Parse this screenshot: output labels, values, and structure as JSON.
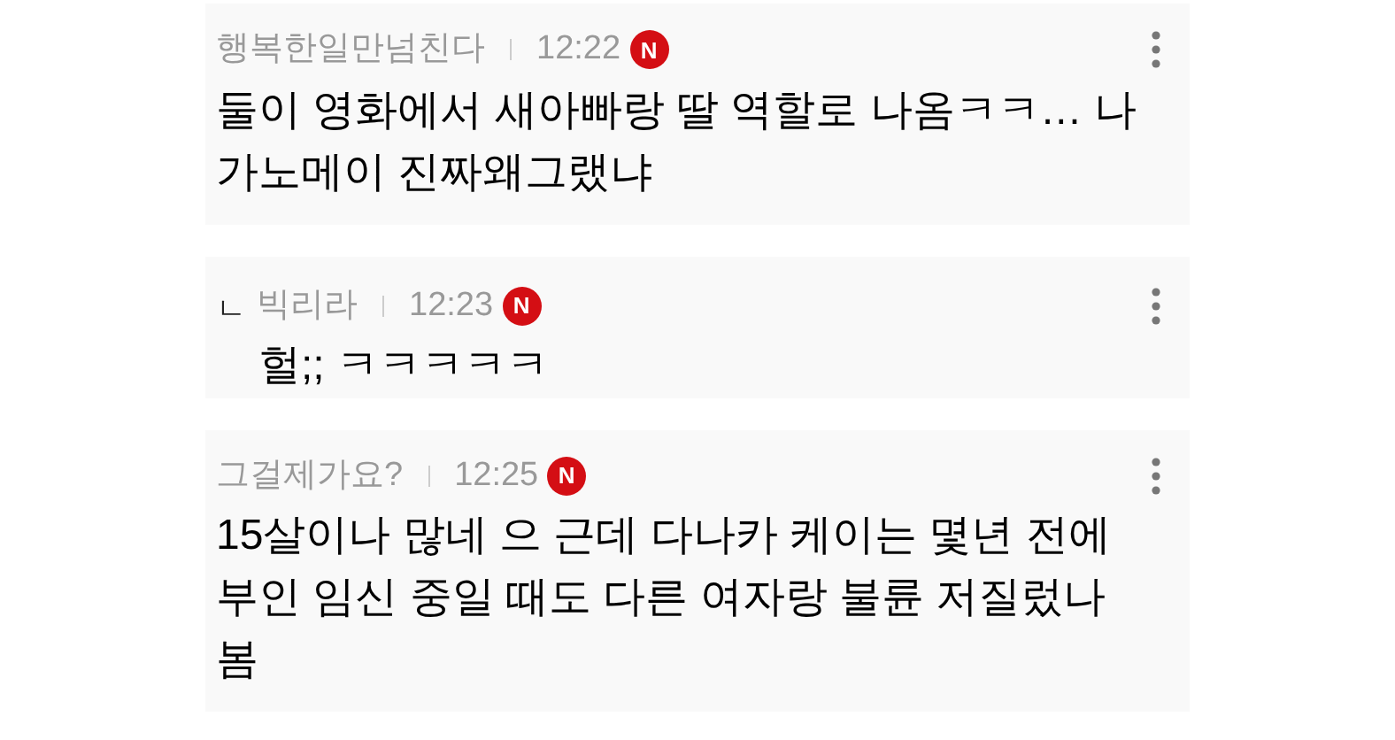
{
  "comments": [
    {
      "kind": "comment",
      "author": "행복한일만넘친다",
      "time": "12:22",
      "badge": "N",
      "body": "둘이 영화에서 새아빠랑 딸 역할로 나옴ㅋㅋ… 나가노메이 진짜왜그랬냐"
    },
    {
      "kind": "reply",
      "marker": "ㄴ",
      "author": "빅리라",
      "time": "12:23",
      "badge": "N",
      "body": "헐;; ㅋㅋㅋㅋㅋ"
    },
    {
      "kind": "comment",
      "author": "그걸제가요?",
      "time": "12:25",
      "badge": "N",
      "body": "15살이나 많네 으 근데 다나카 케이는 몇년 전에 부인 임신 중일 때도 다른 여자랑 불륜 저질렀나 봄"
    }
  ]
}
